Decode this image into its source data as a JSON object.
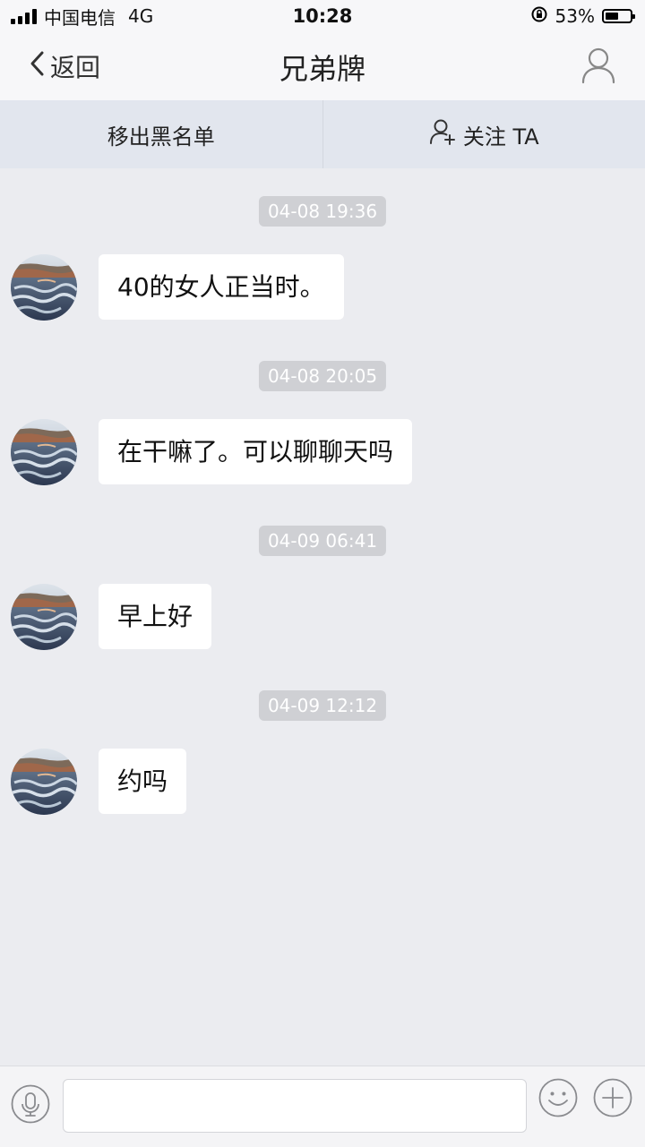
{
  "status_bar": {
    "carrier": "中国电信",
    "network": "4G",
    "time": "10:28",
    "battery_percent": "53%",
    "battery_level": 0.53
  },
  "nav": {
    "back_label": "返回",
    "title": "兄弟牌"
  },
  "actions": {
    "remove_blacklist": "移出黑名单",
    "follow": "关注 TA"
  },
  "messages": [
    {
      "timestamp": "04-08 19:36",
      "text": "40的女人正当时。"
    },
    {
      "timestamp": "04-08 20:05",
      "text": "在干嘛了。可以聊聊天吗"
    },
    {
      "timestamp": "04-09 06:41",
      "text": "早上好"
    },
    {
      "timestamp": "04-09 12:12",
      "text": "约吗"
    }
  ],
  "input": {
    "value": "",
    "placeholder": ""
  },
  "icons": {
    "back": "chevron-left-icon",
    "profile": "person-icon",
    "follow": "person-add-icon",
    "voice": "microphone-icon",
    "emoji": "smiley-icon",
    "more": "plus-circle-icon"
  },
  "colors": {
    "background": "#ebecf0",
    "bar": "#f7f7f9",
    "action_bar": "#e2e6ee",
    "timestamp_bg": "#cfd0d4",
    "bubble": "#ffffff"
  }
}
